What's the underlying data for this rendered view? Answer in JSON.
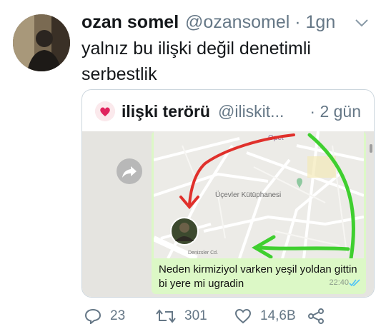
{
  "tweet": {
    "author_name": "ozan somel",
    "author_handle": "@ozansomel",
    "time": "· 1gn",
    "text": "yalnız bu ilişki değil denetimli serbestlik"
  },
  "quoted": {
    "author_name": "ilişki terörü",
    "author_handle": "@iliskit...",
    "time": "· 2 gün",
    "chat": {
      "message": "Neden kirmiziyol varken yeşil yoldan gittin bi yere mi ugradin",
      "time": "22:40",
      "map_labels": {
        "library": "Üçevler Kütüphanesi",
        "place_top": "Opet",
        "street": "Denizsler Cd."
      },
      "route_colors": {
        "red": "#e0302b",
        "green": "#3fcf2f"
      }
    }
  },
  "actions": {
    "reply_count": "23",
    "retweet_count": "301",
    "like_count": "14,6B"
  },
  "colors": {
    "secondary_text": "#657786",
    "bubble": "#dcf8c6",
    "read_ticks": "#4fc3f7"
  }
}
